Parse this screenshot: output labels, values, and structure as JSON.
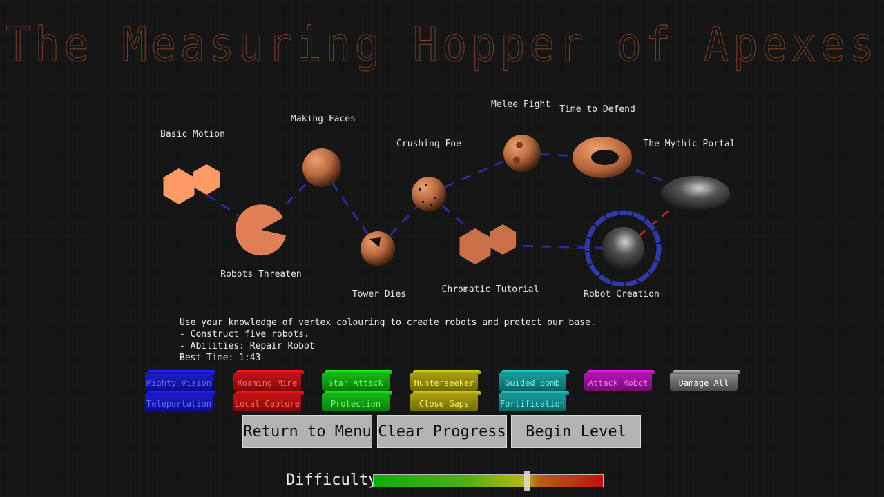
{
  "title": "The Measuring Hopper of Apexes",
  "levels": [
    {
      "name": "Basic Motion",
      "shape": "hexpair",
      "color": "#ff9a66"
    },
    {
      "name": "Robots Threaten",
      "shape": "pacman",
      "color": "#e07f55"
    },
    {
      "name": "Making Faces",
      "shape": "sphere",
      "color": "#c87048"
    },
    {
      "name": "Tower Dies",
      "shape": "sphere-cut",
      "color": "#c87048"
    },
    {
      "name": "Crushing Foe",
      "shape": "sphere-dotted",
      "color": "#c87048"
    },
    {
      "name": "Chromatic Tutorial",
      "shape": "hexpair",
      "color": "#c87048"
    },
    {
      "name": "Melee Fight",
      "shape": "sphere-dented",
      "color": "#c87048"
    },
    {
      "name": "Time to Defend",
      "shape": "torus",
      "color": "#c87048"
    },
    {
      "name": "The Mythic Portal",
      "shape": "capsule",
      "color": "#555555"
    },
    {
      "name": "Robot Creation",
      "shape": "sphere-selected",
      "color": "#666666",
      "selected": true
    }
  ],
  "description": {
    "lines": [
      "Use your knowledge of vertex colouring to create robots and protect our base.",
      "- Construct five robots.",
      "- Abilities: Repair Robot",
      "Best Time: 1:43"
    ]
  },
  "abilities": [
    {
      "label": "Mighty Vision",
      "color": "blue"
    },
    {
      "label": "Teleportation",
      "color": "blue"
    },
    {
      "label": "Roaming Mine",
      "color": "red"
    },
    {
      "label": "Local Capture",
      "color": "red"
    },
    {
      "label": "Star Attack",
      "color": "green"
    },
    {
      "label": "Protection",
      "color": "green"
    },
    {
      "label": "Hunterseeker",
      "color": "yellow"
    },
    {
      "label": "Close Gaps",
      "color": "yellow"
    },
    {
      "label": "Guided Bomb",
      "color": "cyan"
    },
    {
      "label": "Fortification",
      "color": "cyan"
    },
    {
      "label": "Attack Robot",
      "color": "magenta"
    },
    {
      "label": "Damage All",
      "color": "grey"
    }
  ],
  "buttons": {
    "return": "Return to Menu",
    "clear": "Clear Progress",
    "begin": "Begin Level"
  },
  "difficulty": {
    "label": "Difficulty:",
    "value": 0.67
  },
  "colors": {
    "path": "#2a2aa0",
    "active_path": "#c02020",
    "title": "#7a3f24",
    "selection_ring": "#2e3aa8"
  }
}
